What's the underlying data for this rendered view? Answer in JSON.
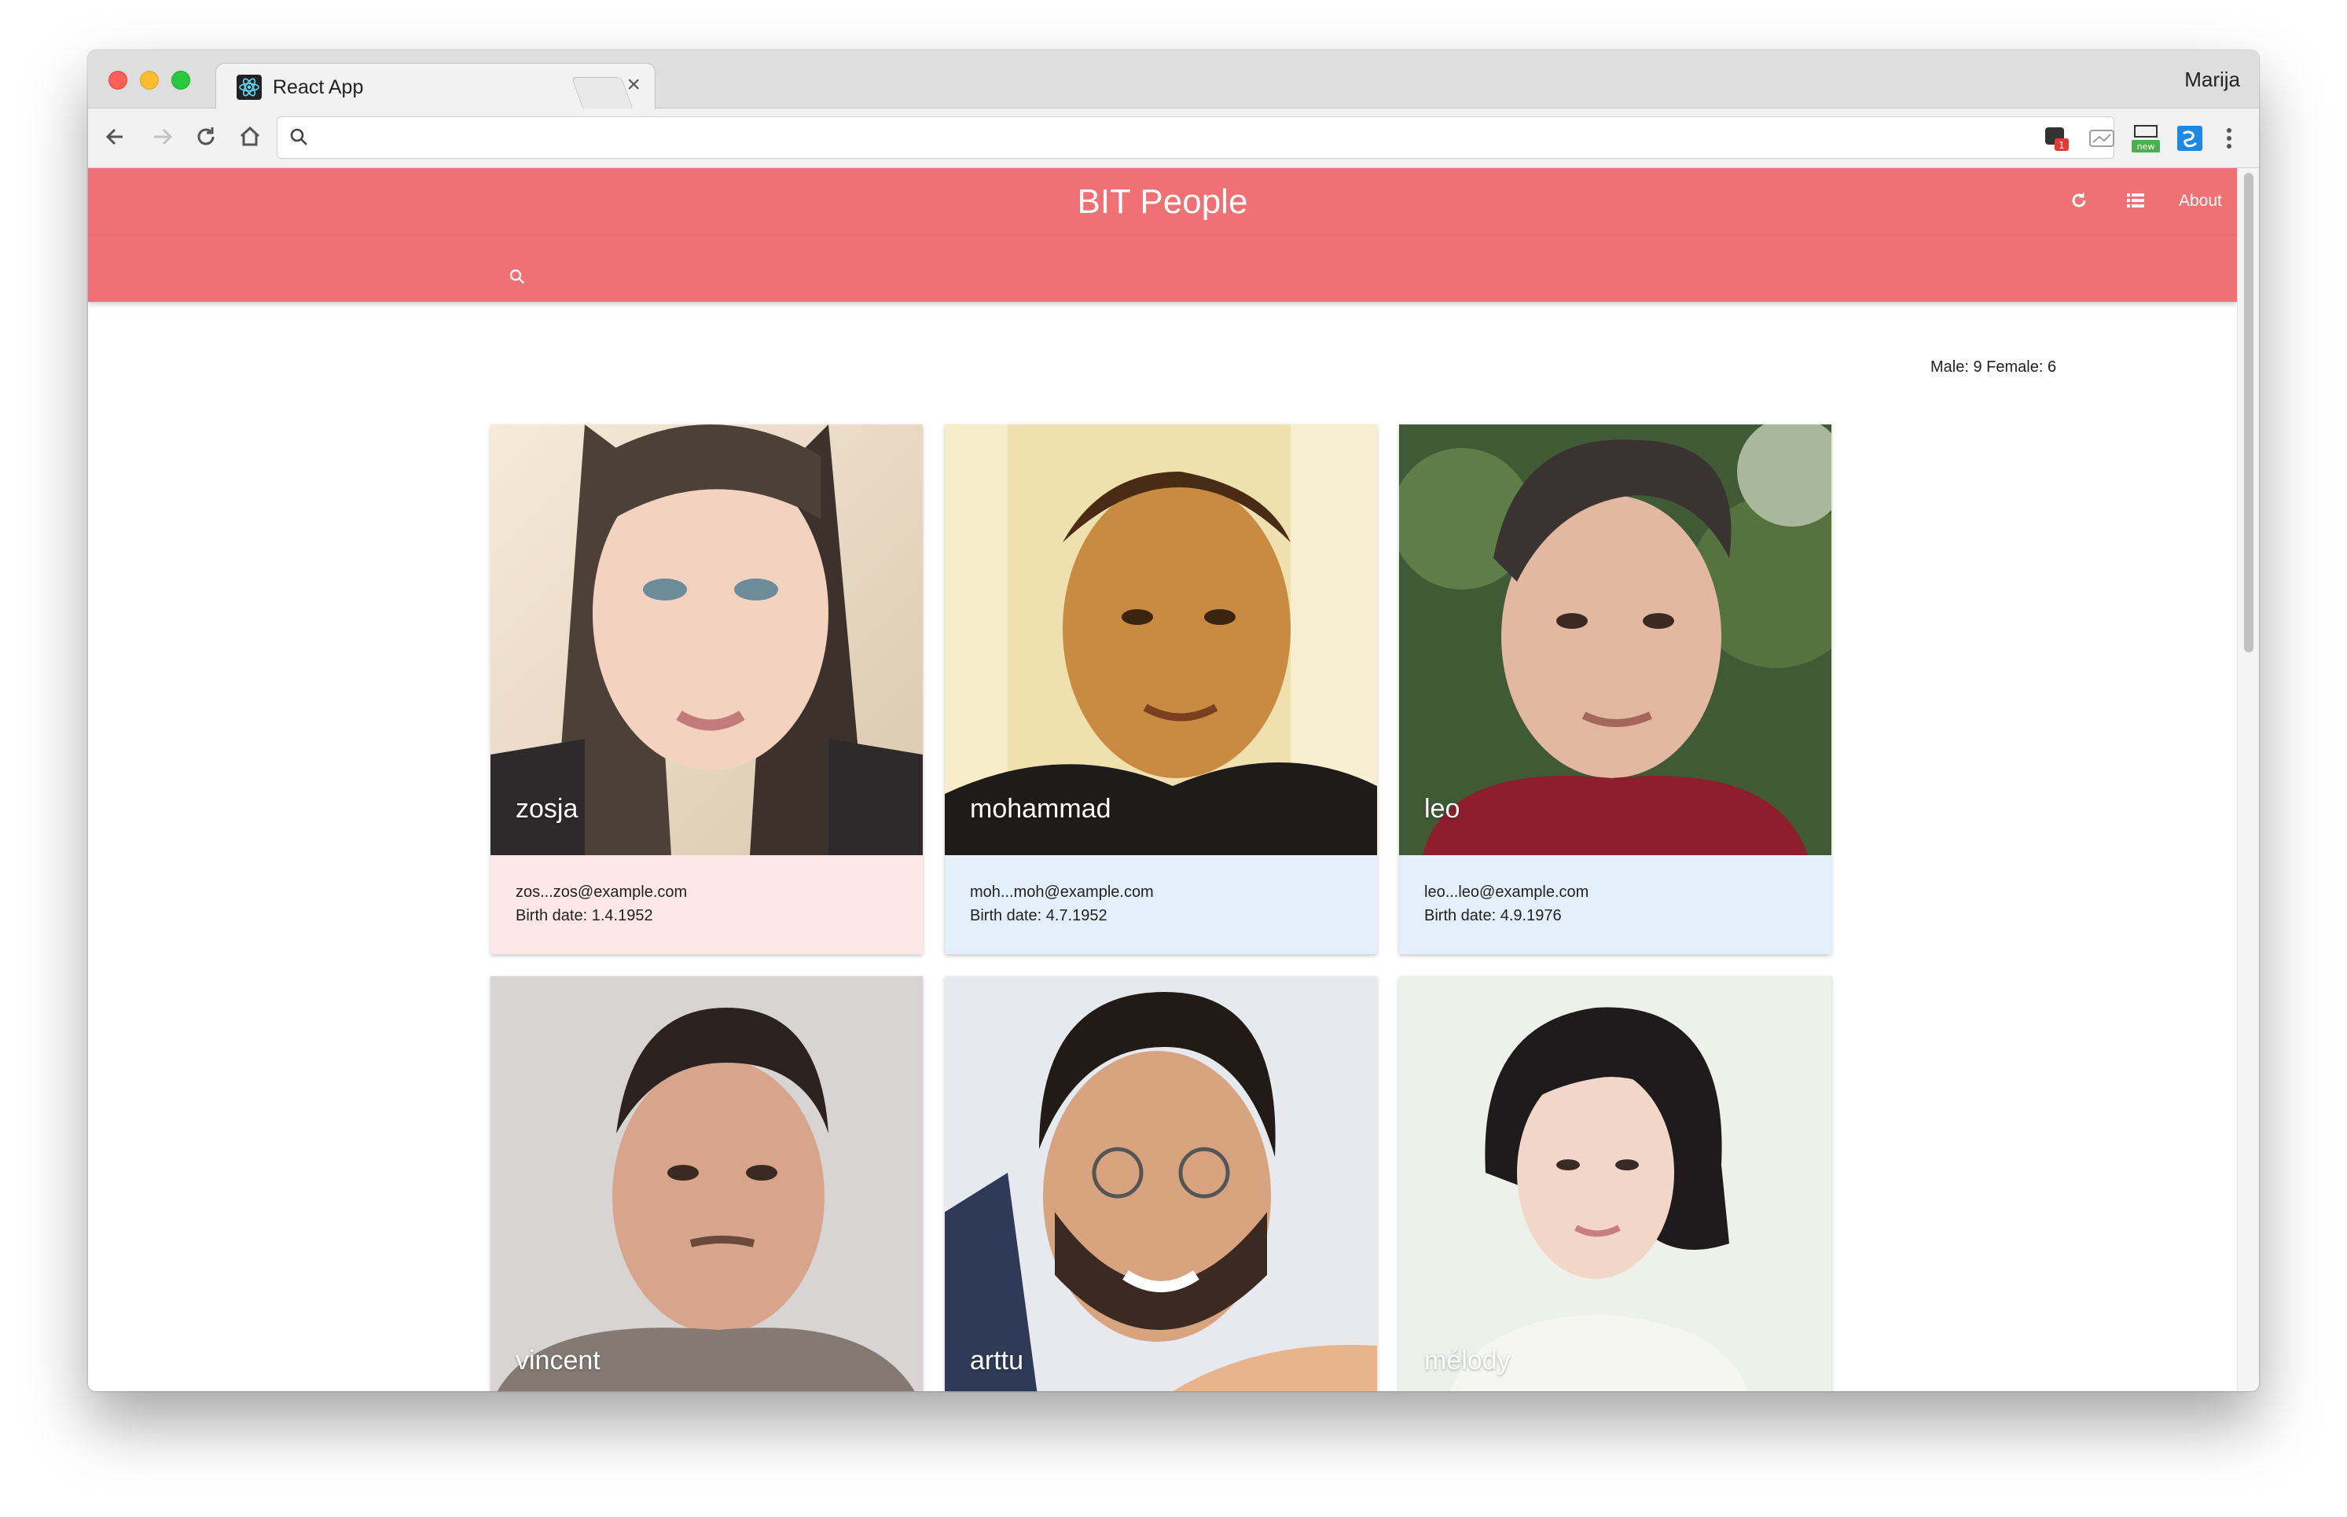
{
  "browser": {
    "tab_title": "React App",
    "tab_close": "×",
    "profile_name": "Marija",
    "address_value": ""
  },
  "app": {
    "title": "BIT People",
    "about_label": "About",
    "search_placeholder": "",
    "stats": "Male: 9 Female: 6"
  },
  "colors": {
    "header": "#ef7173",
    "female_card": "#fde7e8",
    "male_card": "#e3f0fb"
  },
  "users": [
    {
      "name": "zosja",
      "email": "zos...zos@example.com",
      "birth": "Birth date: 1.4.1952",
      "gender": "female"
    },
    {
      "name": "mohammad",
      "email": "moh...moh@example.com",
      "birth": "Birth date: 4.7.1952",
      "gender": "male"
    },
    {
      "name": "leo",
      "email": "leo...leo@example.com",
      "birth": "Birth date: 4.9.1976",
      "gender": "male"
    },
    {
      "name": "vincent",
      "email": "",
      "birth": "",
      "gender": "male"
    },
    {
      "name": "arttu",
      "email": "",
      "birth": "",
      "gender": "male"
    },
    {
      "name": "mélody",
      "email": "",
      "birth": "",
      "gender": "female"
    }
  ]
}
